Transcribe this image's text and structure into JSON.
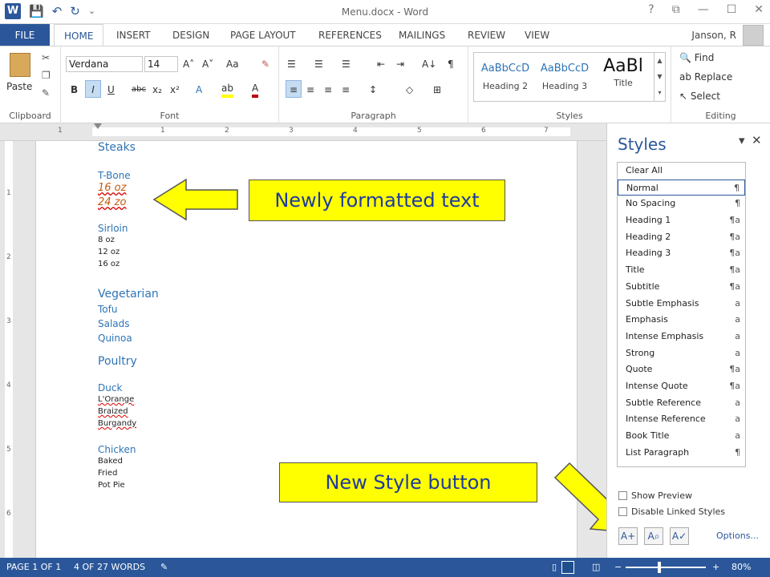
{
  "window": {
    "title": "Menu.docx - Word",
    "controls": [
      "?",
      "⧉",
      "—",
      "☐",
      "✕"
    ]
  },
  "qat": [
    "W",
    "💾",
    "↶",
    "↻",
    "⌄"
  ],
  "tabs": {
    "file": "FILE",
    "items": [
      "HOME",
      "INSERT",
      "DESIGN",
      "PAGE LAYOUT",
      "REFERENCES",
      "MAILINGS",
      "REVIEW",
      "VIEW"
    ],
    "user": "Janson, R"
  },
  "ribbon": {
    "clipboard": {
      "label": "Clipboard",
      "paste": "Paste"
    },
    "font": {
      "label": "Font",
      "name": "Verdana",
      "size": "14",
      "grow": "A˄",
      "shrink": "A˅",
      "case": "Aa",
      "clear": "✎",
      "bold": "B",
      "italic": "I",
      "underline": "U",
      "strike": "abc",
      "sub": "x₂",
      "sup": "x²",
      "effects": "A",
      "highlight": "ab",
      "color": "A"
    },
    "paragraph": {
      "label": "Paragraph",
      "bullets": "☰",
      "numbering": "☰",
      "multilevel": "☰",
      "dec_indent": "⇤",
      "inc_indent": "⇥",
      "sort": "A↓",
      "pilcrow": "¶",
      "align_left": "≡",
      "center": "≡",
      "align_right": "≡",
      "justify": "≡",
      "spacing": "↕",
      "shading": "◇",
      "borders": "⊞"
    },
    "styles": {
      "label": "Styles",
      "gallery": [
        {
          "sample": "AaBbCcD",
          "name": "Heading 2"
        },
        {
          "sample": "AaBbCcD",
          "name": "Heading 3"
        },
        {
          "sample": "AaBl",
          "name": "Title"
        }
      ]
    },
    "editing": {
      "label": "Editing",
      "find": "Find",
      "replace": "Replace",
      "select": "Select"
    }
  },
  "ruler": {
    "numbers": [
      "1",
      "1",
      "2",
      "3",
      "4",
      "5",
      "6",
      "7"
    ]
  },
  "vruler": {
    "numbers": [
      "1",
      "2",
      "3",
      "4",
      "5",
      "6"
    ]
  },
  "document": {
    "steaks": "Steaks",
    "tbone": "T-Bone",
    "tbone_items": [
      "16 oz",
      "24 zo"
    ],
    "sirloin": "Sirloin",
    "sirloin_items": [
      "8 oz",
      "12 oz",
      "16 oz"
    ],
    "vegetarian": "Vegetarian",
    "veg_items": [
      "Tofu",
      "Salads",
      "Quinoa"
    ],
    "poultry": "Poultry",
    "duck": "Duck",
    "duck_items": [
      "L'Orange",
      "Braized",
      "Burgandy"
    ],
    "chicken": "Chicken",
    "chicken_items": [
      "Baked",
      "Fried",
      "Pot Pie"
    ]
  },
  "callouts": {
    "formatted": "Newly formatted text",
    "new_style": "New Style button"
  },
  "styles_pane": {
    "title": "Styles",
    "pin": "▾",
    "close": "✕",
    "items": [
      {
        "name": "Clear All",
        "icon": ""
      },
      {
        "name": "Normal",
        "icon": "¶"
      },
      {
        "name": "No Spacing",
        "icon": "¶"
      },
      {
        "name": "Heading 1",
        "icon": "¶a"
      },
      {
        "name": "Heading 2",
        "icon": "¶a"
      },
      {
        "name": "Heading 3",
        "icon": "¶a"
      },
      {
        "name": "Title",
        "icon": "¶a"
      },
      {
        "name": "Subtitle",
        "icon": "¶a"
      },
      {
        "name": "Subtle Emphasis",
        "icon": "a"
      },
      {
        "name": "Emphasis",
        "icon": "a"
      },
      {
        "name": "Intense Emphasis",
        "icon": "a"
      },
      {
        "name": "Strong",
        "icon": "a"
      },
      {
        "name": "Quote",
        "icon": "¶a"
      },
      {
        "name": "Intense Quote",
        "icon": "¶a"
      },
      {
        "name": "Subtle Reference",
        "icon": "a"
      },
      {
        "name": "Intense Reference",
        "icon": "a"
      },
      {
        "name": "Book Title",
        "icon": "a"
      },
      {
        "name": "List Paragraph",
        "icon": "¶"
      }
    ],
    "show_preview": "Show Preview",
    "disable_linked": "Disable Linked Styles",
    "new_style_icon": "A+",
    "inspector_icon": "A⌕",
    "manage_icon": "A✓",
    "options": "Options..."
  },
  "status": {
    "page": "PAGE 1 OF 1",
    "words": "4 OF 27 WORDS",
    "zoom": "80%"
  }
}
